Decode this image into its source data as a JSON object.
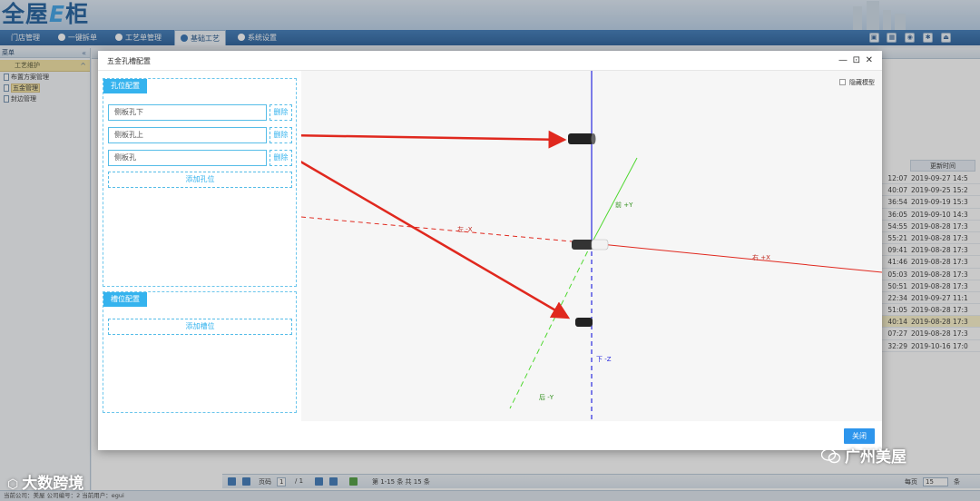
{
  "app": {
    "logo": "全屋",
    "logo_e": "E",
    "logo_tail": "柜"
  },
  "nav": {
    "items": [
      "门店管理",
      "一键拆单",
      "工艺单管理",
      "基础工艺",
      "系统设置"
    ],
    "active_index": 3
  },
  "sidebar": {
    "title": "菜单",
    "section": "工艺维护",
    "items": [
      "布置方案管理",
      "五金管理",
      "封边管理"
    ],
    "selected_index": 1
  },
  "background_grid": {
    "column_header": "更新时间",
    "rows": [
      {
        "t1": "12:07",
        "t2": "2019-09-27 14:5"
      },
      {
        "t1": "40:07",
        "t2": "2019-09-25 15:2"
      },
      {
        "t1": "36:54",
        "t2": "2019-09-19 15:3"
      },
      {
        "t1": "36:05",
        "t2": "2019-09-10 14:3"
      },
      {
        "t1": "54:55",
        "t2": "2019-08-28 17:3"
      },
      {
        "t1": "55:21",
        "t2": "2019-08-28 17:3"
      },
      {
        "t1": "09:41",
        "t2": "2019-08-28 17:3"
      },
      {
        "t1": "41:46",
        "t2": "2019-08-28 17:3"
      },
      {
        "t1": "05:03",
        "t2": "2019-08-28 17:3"
      },
      {
        "t1": "50:51",
        "t2": "2019-08-28 17:3"
      },
      {
        "t1": "22:34",
        "t2": "2019-09-27 11:1"
      },
      {
        "t1": "51:05",
        "t2": "2019-08-28 17:3"
      },
      {
        "t1": "40:14",
        "t2": "2019-08-28 17:3"
      },
      {
        "t1": "07:27",
        "t2": "2019-08-28 17:3"
      },
      {
        "t1": "32:29",
        "t2": "2019-10-16 17:0"
      }
    ],
    "highlight_index": 12
  },
  "pager": {
    "page_label": "页码",
    "page": "1",
    "of": "/ 1",
    "summary": "第 1-15 条  共 15 条",
    "per_page_label": "每页",
    "per_page": "15",
    "unit": "条"
  },
  "status_bar": "当前公司：美屋  公司编号：2  当前用户：egui",
  "modal": {
    "title": "五金孔槽配置",
    "hole_panel": {
      "tag": "孔位配置",
      "holes": [
        "侧板孔下",
        "侧板孔上",
        "侧板孔"
      ],
      "delete_label": "删除",
      "add_label": "添加孔位"
    },
    "slot_panel": {
      "tag": "槽位配置",
      "add_label": "添加槽位"
    },
    "hide_model_label": "隐藏模型",
    "close_label": "关闭",
    "axes": {
      "up": "前 +Y",
      "down": "后 -Y",
      "left": "左 -X",
      "right": "右 +X",
      "z": "下 -Z"
    }
  },
  "watermark": {
    "left": "大数跨境",
    "right": "广州美屋"
  },
  "colors": {
    "accent": "#35b3ee",
    "nav": "#255d99",
    "arrow": "#e0281e"
  }
}
